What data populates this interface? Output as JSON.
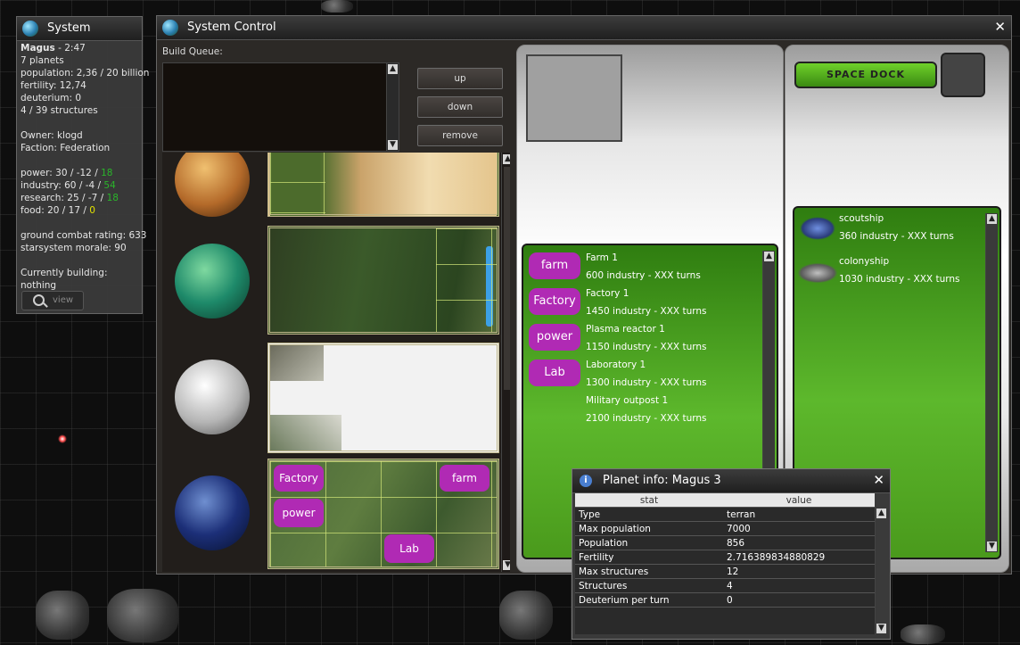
{
  "system_panel": {
    "title": "System",
    "name": "Magus",
    "stardate": " - 2:47",
    "planets": "7 planets",
    "population": "population: 2,36 / 20 billion",
    "fertility": "fertility: 12,74",
    "deuterium": "deuterium: 0",
    "structures": "4 / 39 structures",
    "owner": "Owner: klogd",
    "faction": "Faction: Federation",
    "power_prefix": "power: 30 / -12 / ",
    "power_net": "18",
    "industry_prefix": "industry: 60 / -4 / ",
    "industry_net": "54",
    "research_prefix": "research: 25 / -7 / ",
    "research_net": "18",
    "food_prefix": "food: 20 / 17 / ",
    "food_net": "0",
    "ground_combat": "ground combat rating: 633",
    "morale": "starsystem morale: 90",
    "currently_building_label": "Currently building:",
    "currently_building": "nothing",
    "view_label": "view"
  },
  "control": {
    "title": "System Control",
    "close": "✕",
    "build_queue_label": "Build Queue:",
    "up_label": "up",
    "down_label": "down",
    "remove_label": "remove",
    "space_dock_label": "SPACE DOCK"
  },
  "surface_buttons": {
    "factory": "Factory",
    "farm": "farm",
    "power": "power",
    "lab": "Lab"
  },
  "structures": [
    {
      "btn": "farm",
      "name": "Farm 1",
      "cost": "600 industry -  XXX turns"
    },
    {
      "btn": "Factory",
      "name": "Factory 1",
      "cost": "1450 industry -  XXX turns"
    },
    {
      "btn": "power",
      "name": "Plasma reactor 1",
      "cost": "1150 industry -  XXX turns"
    },
    {
      "btn": "Lab",
      "name": "Laboratory 1",
      "cost": "1300 industry -  XXX turns"
    },
    {
      "btn": "",
      "name": "Military outpost 1",
      "cost": "2100 industry -  XXX turns"
    }
  ],
  "ships": [
    {
      "name": "scoutship",
      "cost": "360 industry -  XXX turns",
      "icon": "scoutship-icon"
    },
    {
      "name": "colonyship",
      "cost": "1030 industry -  XXX turns",
      "icon": "colonyship-icon"
    }
  ],
  "planet_info": {
    "title": "Planet info: Magus 3",
    "close": "✕",
    "col_stat": "stat",
    "col_value": "value",
    "rows": [
      {
        "stat": "Type",
        "value": "terran"
      },
      {
        "stat": "Max population",
        "value": "7000"
      },
      {
        "stat": "Population",
        "value": "856"
      },
      {
        "stat": "Fertility",
        "value": "2.716389834880829"
      },
      {
        "stat": "Max structures",
        "value": "12"
      },
      {
        "stat": "Structures",
        "value": "4"
      },
      {
        "stat": "Deuterium per turn",
        "value": "0"
      }
    ]
  },
  "colors": {
    "accent_magenta": "#b02ab4",
    "green_panel": "#5db82c",
    "positive": "#2ab52a",
    "zero": "#e0e000"
  }
}
